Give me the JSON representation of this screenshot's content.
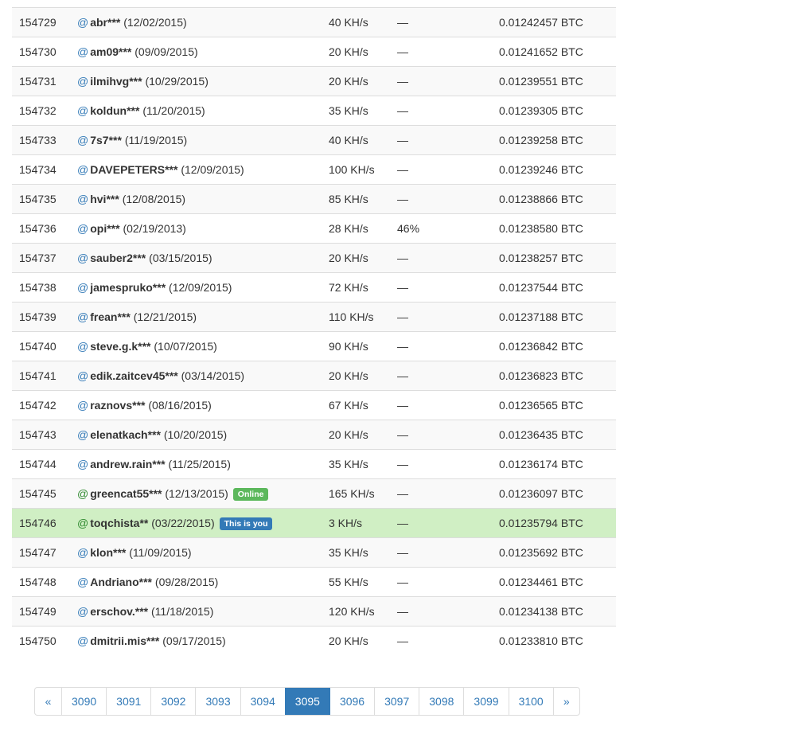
{
  "rows": [
    {
      "rank": "154729",
      "at": "@",
      "username": "abr***",
      "joined": "(12/02/2015)",
      "speed": "40 KH/s",
      "progress": "—",
      "reward": "0.01242457 BTC"
    },
    {
      "rank": "154730",
      "at": "@",
      "username": "am09***",
      "joined": "(09/09/2015)",
      "speed": "20 KH/s",
      "progress": "—",
      "reward": "0.01241652 BTC"
    },
    {
      "rank": "154731",
      "at": "@",
      "username": "ilmihvg***",
      "joined": "(10/29/2015)",
      "speed": "20 KH/s",
      "progress": "—",
      "reward": "0.01239551 BTC"
    },
    {
      "rank": "154732",
      "at": "@",
      "username": "koldun***",
      "joined": "(11/20/2015)",
      "speed": "35 KH/s",
      "progress": "—",
      "reward": "0.01239305 BTC"
    },
    {
      "rank": "154733",
      "at": "@",
      "username": "7s7***",
      "joined": "(11/19/2015)",
      "speed": "40 KH/s",
      "progress": "—",
      "reward": "0.01239258 BTC"
    },
    {
      "rank": "154734",
      "at": "@",
      "username": "DAVEPETERS***",
      "joined": "(12/09/2015)",
      "speed": "100 KH/s",
      "progress": "—",
      "reward": "0.01239246 BTC"
    },
    {
      "rank": "154735",
      "at": "@",
      "username": "hvi***",
      "joined": "(12/08/2015)",
      "speed": "85 KH/s",
      "progress": "—",
      "reward": "0.01238866 BTC"
    },
    {
      "rank": "154736",
      "at": "@",
      "username": "opi***",
      "joined": "(02/19/2013)",
      "speed": "28 KH/s",
      "progress": "46%",
      "reward": "0.01238580 BTC"
    },
    {
      "rank": "154737",
      "at": "@",
      "username": "sauber2***",
      "joined": "(03/15/2015)",
      "speed": "20 KH/s",
      "progress": "—",
      "reward": "0.01238257 BTC"
    },
    {
      "rank": "154738",
      "at": "@",
      "username": "jamespruko***",
      "joined": "(12/09/2015)",
      "speed": "72 KH/s",
      "progress": "—",
      "reward": "0.01237544 BTC"
    },
    {
      "rank": "154739",
      "at": "@",
      "username": "frean***",
      "joined": "(12/21/2015)",
      "speed": "110 KH/s",
      "progress": "—",
      "reward": "0.01237188 BTC"
    },
    {
      "rank": "154740",
      "at": "@",
      "username": "steve.g.k***",
      "joined": "(10/07/2015)",
      "speed": "90 KH/s",
      "progress": "—",
      "reward": "0.01236842 BTC"
    },
    {
      "rank": "154741",
      "at": "@",
      "username": "edik.zaitcev45***",
      "joined": "(03/14/2015)",
      "speed": "20 KH/s",
      "progress": "—",
      "reward": "0.01236823 BTC"
    },
    {
      "rank": "154742",
      "at": "@",
      "username": "raznovs***",
      "joined": "(08/16/2015)",
      "speed": "67 KH/s",
      "progress": "—",
      "reward": "0.01236565 BTC"
    },
    {
      "rank": "154743",
      "at": "@",
      "username": "elenatkach***",
      "joined": "(10/20/2015)",
      "speed": "20 KH/s",
      "progress": "—",
      "reward": "0.01236435 BTC"
    },
    {
      "rank": "154744",
      "at": "@",
      "username": "andrew.rain***",
      "joined": "(11/25/2015)",
      "speed": "35 KH/s",
      "progress": "—",
      "reward": "0.01236174 BTC"
    },
    {
      "rank": "154745",
      "at": "@",
      "username": "greencat55***",
      "joined": "(12/13/2015)",
      "speed": "165 KH/s",
      "progress": "—",
      "reward": "0.01236097 BTC",
      "badge": "Online",
      "badge_type": "online"
    },
    {
      "rank": "154746",
      "at": "@",
      "username": "toqchista**",
      "joined": "(03/22/2015)",
      "speed": "3 KH/s",
      "progress": "—",
      "reward": "0.01235794 BTC",
      "badge": "This is you",
      "badge_type": "you",
      "current": true
    },
    {
      "rank": "154747",
      "at": "@",
      "username": "klon***",
      "joined": "(11/09/2015)",
      "speed": "35 KH/s",
      "progress": "—",
      "reward": "0.01235692 BTC"
    },
    {
      "rank": "154748",
      "at": "@",
      "username": "Andriano***",
      "joined": "(09/28/2015)",
      "speed": "55 KH/s",
      "progress": "—",
      "reward": "0.01234461 BTC"
    },
    {
      "rank": "154749",
      "at": "@",
      "username": "erschov.***",
      "joined": "(11/18/2015)",
      "speed": "120 KH/s",
      "progress": "—",
      "reward": "0.01234138 BTC"
    },
    {
      "rank": "154750",
      "at": "@",
      "username": "dmitrii.mis***",
      "joined": "(09/17/2015)",
      "speed": "20 KH/s",
      "progress": "—",
      "reward": "0.01233810 BTC"
    }
  ],
  "pagination": {
    "prev_label": "«",
    "next_label": "»",
    "pages": [
      "3090",
      "3091",
      "3092",
      "3093",
      "3094",
      "3095",
      "3096",
      "3097",
      "3098",
      "3099",
      "3100"
    ],
    "active_page": "3095"
  },
  "colors": {
    "link": "#337ab7",
    "online_badge": "#5cb85c",
    "you_badge": "#337ab7",
    "current_row": "#d0efc4",
    "striped_row": "#f9f9f9"
  }
}
